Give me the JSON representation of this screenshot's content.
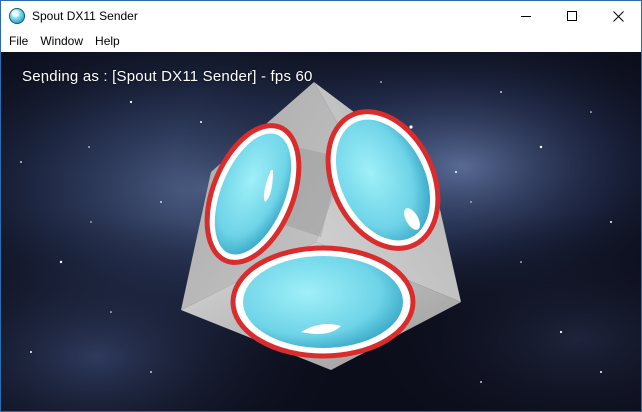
{
  "window": {
    "title": "Spout DX11 Sender",
    "controls": {
      "minimize": "minimize",
      "maximize": "maximize",
      "close": "close"
    }
  },
  "menu": {
    "items": [
      "File",
      "Window",
      "Help"
    ]
  },
  "viewport": {
    "status_text": "Sending as : [Spout DX11 Sender] - fps 60"
  },
  "colors": {
    "titlebar": "#ffffff",
    "border": "#2b6cb0",
    "space_dark": "#0b0d1a",
    "nebula": "#3b4f7a",
    "cube_face": "#bdbdbd",
    "disc_fill": "#7fdcec",
    "disc_rim": "#d92c2c"
  },
  "icons": {
    "app": "spout-ball-icon",
    "minimize": "minimize-icon",
    "maximize": "maximize-icon",
    "close": "close-icon"
  }
}
